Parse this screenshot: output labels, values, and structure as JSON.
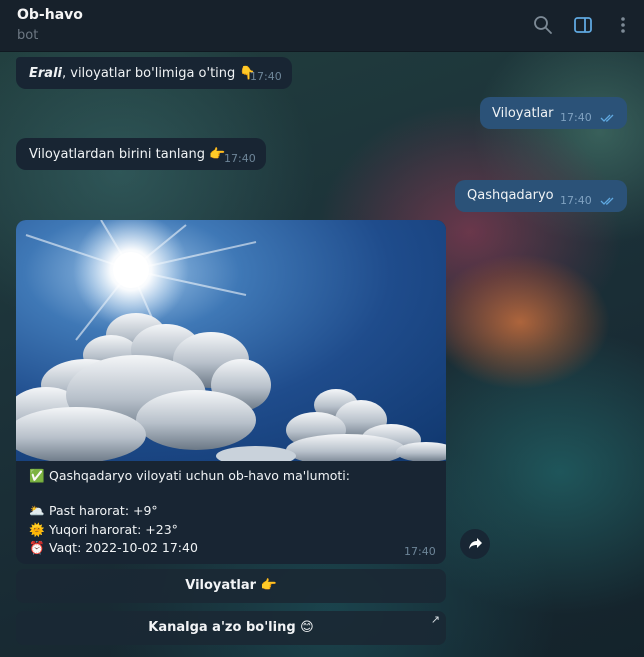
{
  "header": {
    "title": "Ob-havo",
    "subtitle": "bot",
    "icons": [
      "search-icon",
      "sidebar-toggle-icon",
      "more-menu-icon"
    ],
    "accent": "#5fa8e0"
  },
  "messages": [
    {
      "dir": "in",
      "name_bold": "Erali",
      "text": ", viloyatlar bo'limiga o'ting 👇",
      "time": "17:40"
    },
    {
      "dir": "out",
      "text": "Viloyatlar",
      "time": "17:40"
    },
    {
      "dir": "in",
      "text": "Viloyatlardan birini tanlang 👉",
      "time": "17:40"
    },
    {
      "dir": "out",
      "text": "Qashqadaryo",
      "time": "17:40"
    }
  ],
  "weather_post": {
    "image": "sun-and-clouds-photo",
    "line1": "Qashqadaryo viloyati uchun ob-havo ma'lumoti:",
    "line1_icon": "✅",
    "rows": [
      {
        "icon": "🌥️",
        "label": "Past harorat:  +9°"
      },
      {
        "icon": "🌞",
        "label": "Yuqori harorat:  +23°"
      },
      {
        "icon": "⏰",
        "label": "Vaqt: 2022-10-02 17:40"
      }
    ],
    "time": "17:40"
  },
  "keyboard": [
    {
      "label": "Viloyatlar 👉"
    },
    {
      "label": "Kanalga a'zo bo'ling 😊",
      "arrow": "↗"
    }
  ],
  "colors": {
    "header_bg": "#17212b",
    "incoming_bubble": "#182533",
    "outgoing_bubble": "#2b5278",
    "read_checks": "#5fa8e0"
  }
}
